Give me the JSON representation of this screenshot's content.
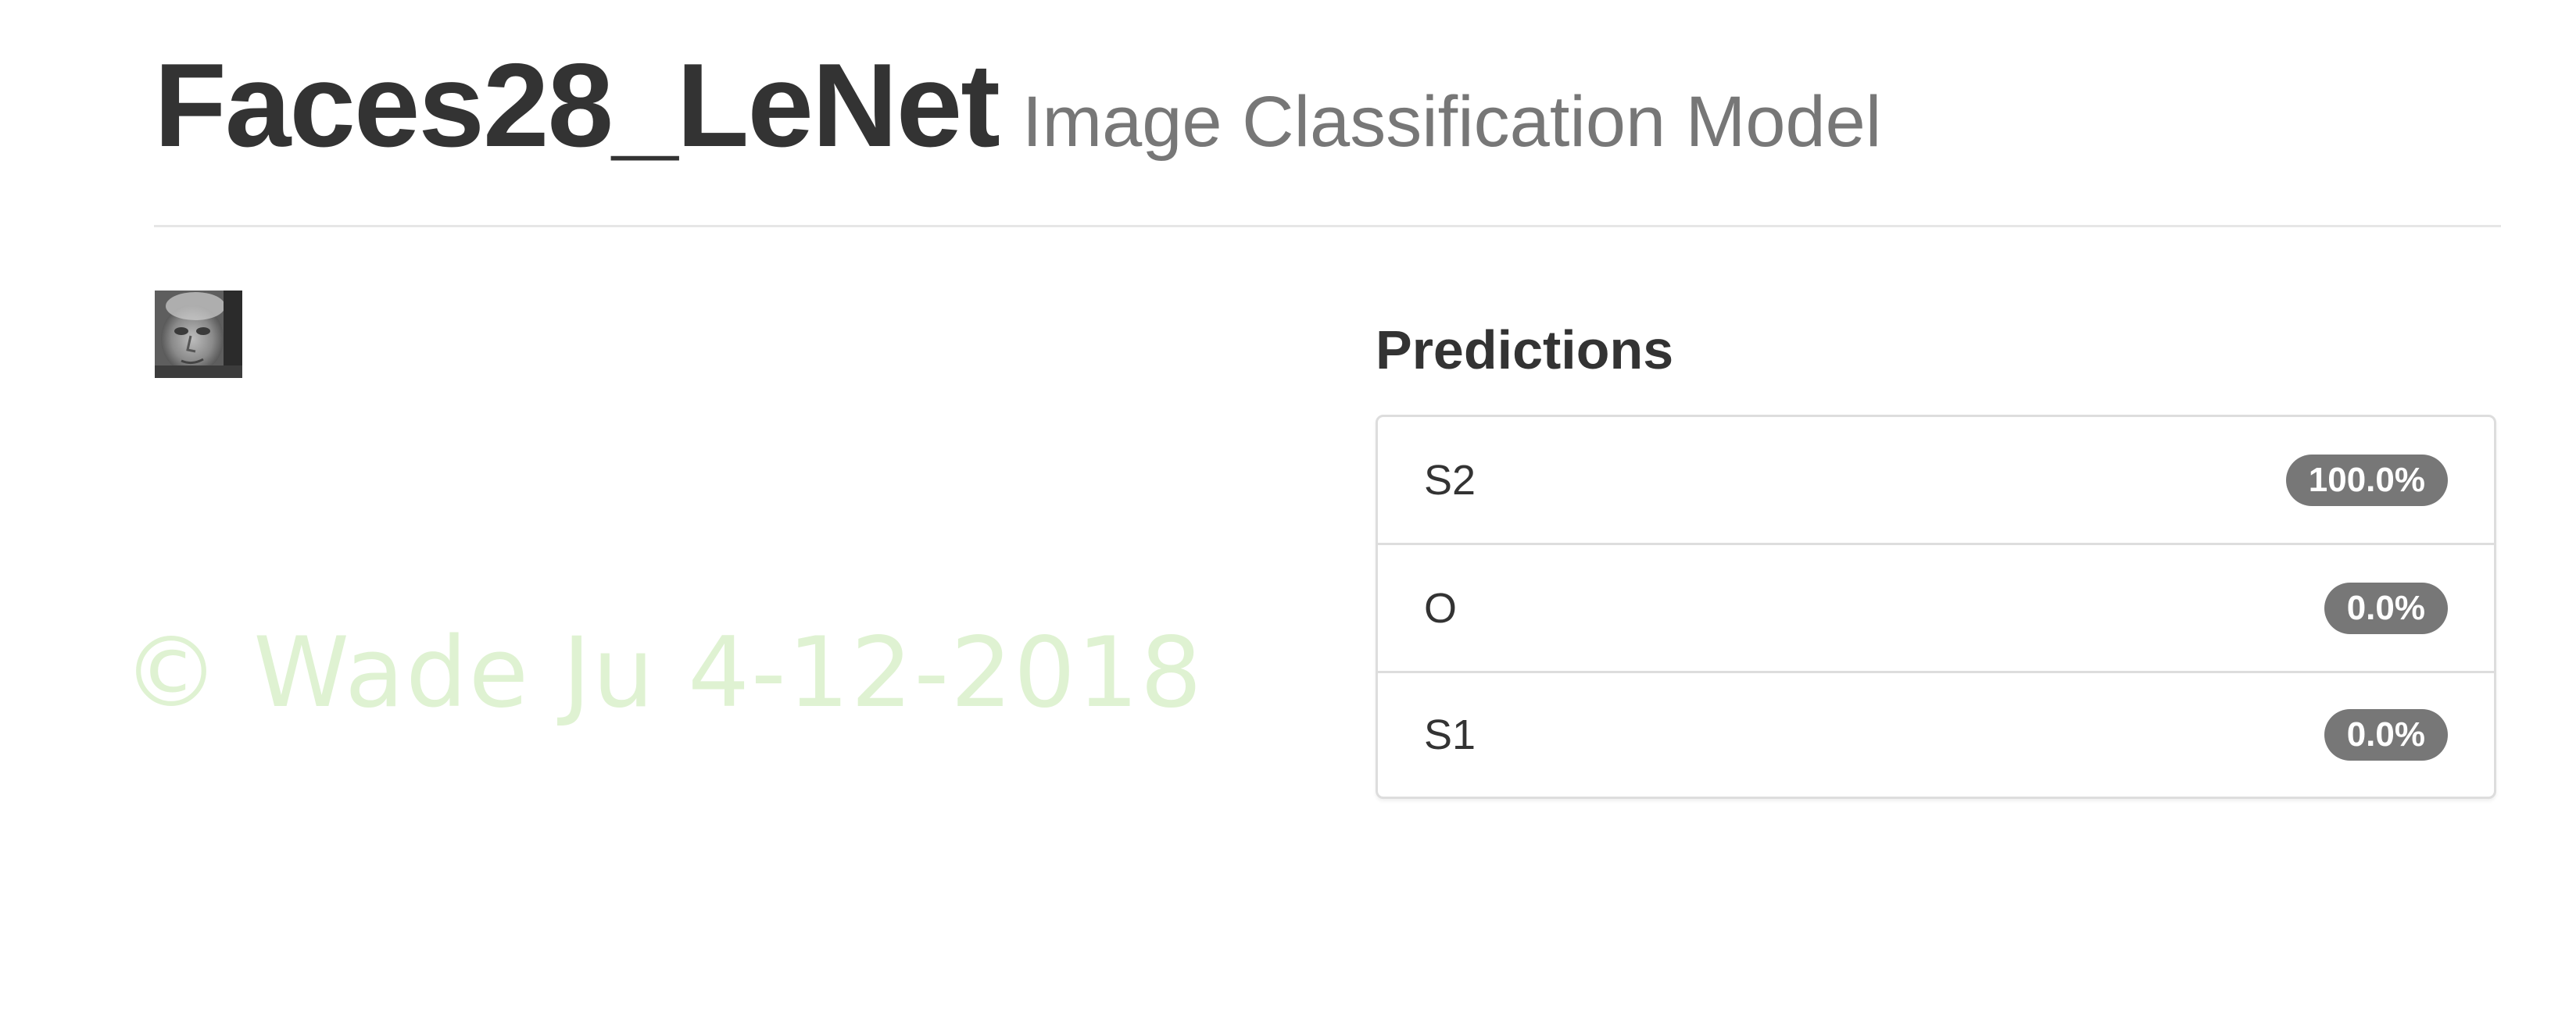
{
  "header": {
    "model_name": "Faces28_LeNet",
    "subtitle": "Image Classification Model"
  },
  "image": {
    "description_icon": "face-thumbnail-icon"
  },
  "watermark": "© Wade Ju 4-12-2018",
  "predictions": {
    "title": "Predictions",
    "items": [
      {
        "label": "S2",
        "percent": "100.0%"
      },
      {
        "label": "O",
        "percent": "0.0%"
      },
      {
        "label": "S1",
        "percent": "0.0%"
      }
    ]
  },
  "colors": {
    "badge": "#777777",
    "watermark": "#dff2d2",
    "divider": "#e6e6e6"
  }
}
